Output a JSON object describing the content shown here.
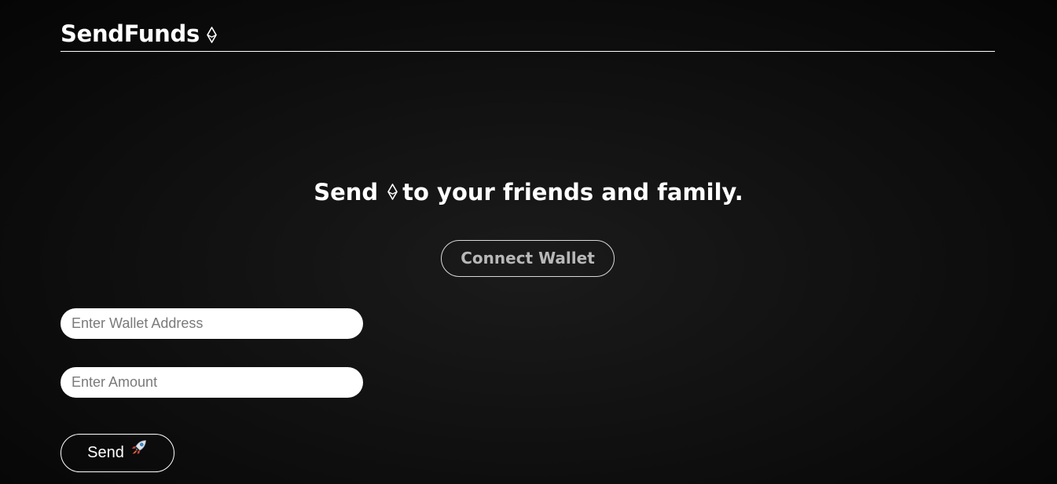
{
  "header": {
    "brand": "SendFunds",
    "brand_icon": "ethereum-icon"
  },
  "hero": {
    "text_before": "Send",
    "icon": "ethereum-icon",
    "text_after": "to your friends and family."
  },
  "wallet": {
    "connect_label": "Connect Wallet"
  },
  "form": {
    "address_placeholder": "Enter Wallet Address",
    "address_value": "",
    "amount_placeholder": "Enter Amount",
    "amount_value": "",
    "send_label": "Send",
    "send_icon": "rocket-icon"
  },
  "colors": {
    "background": "#111111",
    "text": "#ffffff",
    "connect_text": "#b8b8b8",
    "rocket_body": "#dfe6ee",
    "rocket_flame": "#f0642c",
    "rocket_window": "#3b8fd9"
  }
}
